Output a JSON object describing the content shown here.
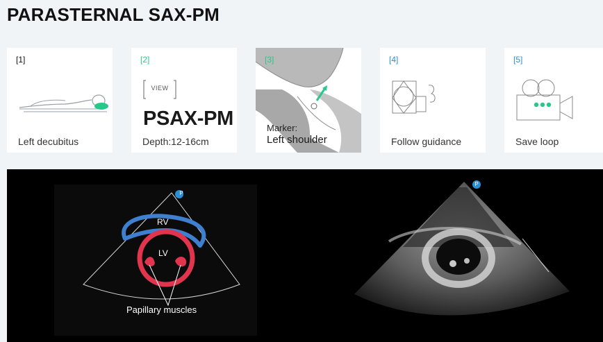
{
  "page": {
    "title": "PARASTERNAL SAX-PM"
  },
  "steps": [
    {
      "number": "[1]",
      "label": "Left decubitus"
    },
    {
      "number": "[2]",
      "view_tag": "VIEW",
      "view_code": "PSAX-PM",
      "label": "Depth:12-16cm"
    },
    {
      "number": "[3]",
      "marker_label": "Marker:",
      "marker_value": "Left shoulder"
    },
    {
      "number": "[4]",
      "label": "Follow guidance"
    },
    {
      "number": "[5]",
      "label": "Save loop"
    }
  ],
  "diagram": {
    "rv_label": "RV",
    "lv_label": "LV",
    "papillary_label": "Papillary muscles",
    "probe_marker": "P"
  },
  "ultrasound": {
    "probe_marker": "P"
  },
  "colors": {
    "accent_green": "#27c98a",
    "accent_blue": "#2a8fd6",
    "rv_blue": "#3f7fd0",
    "lv_red": "#e0354d"
  }
}
